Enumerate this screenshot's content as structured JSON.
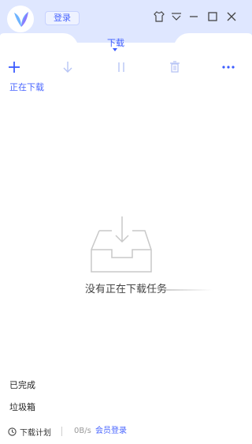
{
  "header": {
    "login_label": "登录",
    "tab_label": "下载"
  },
  "toolbar": {
    "icons": [
      "add-icon",
      "download-arrow-icon",
      "pause-icon",
      "trash-icon",
      "more-icon"
    ]
  },
  "downloading": {
    "section_label": "正在下载",
    "empty_text": "没有正在下载任务"
  },
  "nav": {
    "completed_label": "已完成",
    "trash_label": "垃圾箱"
  },
  "status": {
    "plan_label": "下载计划",
    "speed": "0B/s",
    "member_login_label": "会员登录"
  },
  "colors": {
    "accent": "#4a66ff",
    "header_bg": "#dfe7ff"
  }
}
